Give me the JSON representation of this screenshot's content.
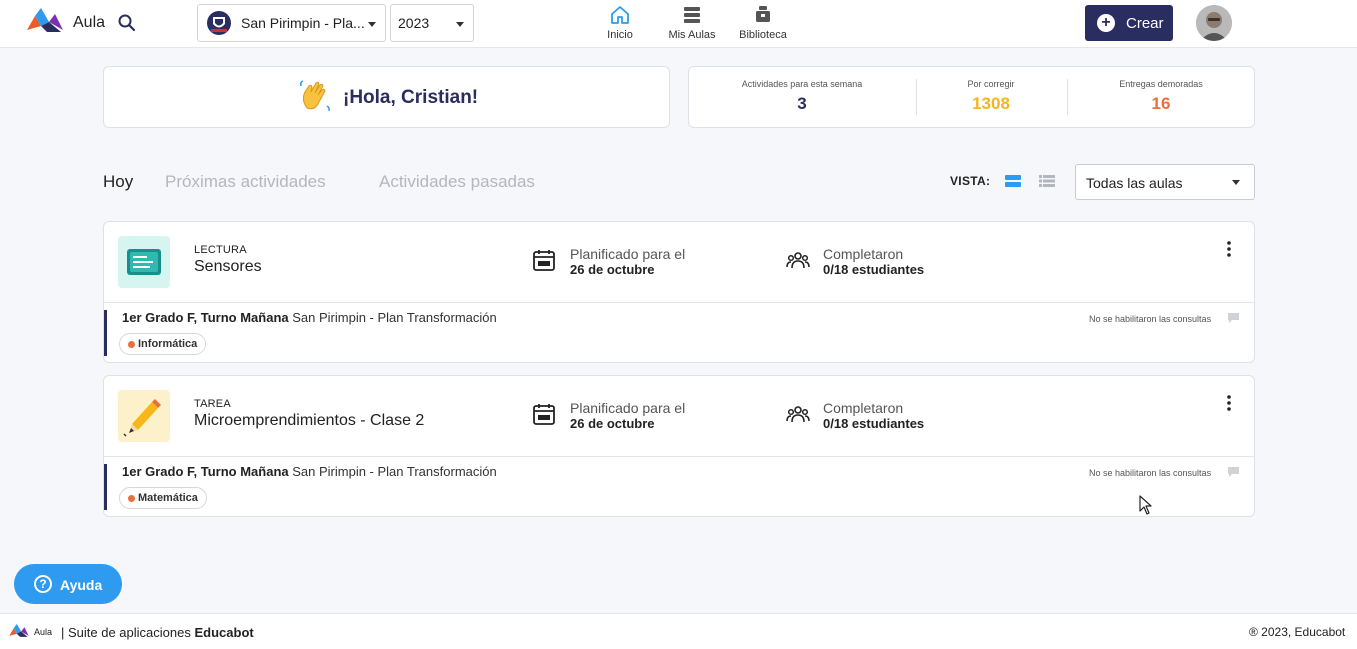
{
  "header": {
    "app_name": "Aula",
    "school_select": "San Pirimpin - Pla...",
    "year_select": "2023",
    "nav": [
      {
        "label": "Inicio",
        "icon": "home-icon",
        "active": true
      },
      {
        "label": "Mis Aulas",
        "icon": "classrooms-icon",
        "active": false
      },
      {
        "label": "Biblioteca",
        "icon": "library-icon",
        "active": false
      }
    ],
    "create_label": "Crear"
  },
  "greeting": {
    "text": "¡Hola, Cristian!"
  },
  "stats": [
    {
      "label": "Actividades para esta semana",
      "value": "3",
      "color": "#2a2d5f"
    },
    {
      "label": "Por corregir",
      "value": "1308",
      "color": "#f5b41a"
    },
    {
      "label": "Entregas demoradas",
      "value": "16",
      "color": "#e8703a"
    }
  ],
  "tabs": [
    {
      "label": "Hoy",
      "active": true
    },
    {
      "label": "Próximas actividades",
      "active": false
    },
    {
      "label": "Actividades pasadas",
      "active": false
    }
  ],
  "view": {
    "label": "VISTA:",
    "filter": "Todas las aulas"
  },
  "activities": [
    {
      "type": "LECTURA",
      "title": "Sensores",
      "plan_label": "Planificado para el",
      "plan_date": "26 de octubre",
      "completed_label": "Completaron",
      "completed_value": "0/18 estudiantes",
      "class_name": "1er Grado F, Turno Mañana",
      "school": "San Pirimpin - Plan Transformación",
      "subject": "Informática",
      "consult_note": "No se habilitaron las consultas"
    },
    {
      "type": "TAREA",
      "title": "Microemprendimientos - Clase 2",
      "plan_label": "Planificado para el",
      "plan_date": "26 de octubre",
      "completed_label": "Completaron",
      "completed_value": "0/18 estudiantes",
      "class_name": "1er Grado F, Turno Mañana",
      "school": "San Pirimpin - Plan Transformación",
      "subject": "Matemática",
      "consult_note": "No se habilitaron las consultas"
    }
  ],
  "help": {
    "label": "Ayuda"
  },
  "footer": {
    "logo_text": "Aula",
    "suite_prefix": "| Suite de aplicaciones",
    "suite_brand": "Educabot",
    "copyright": "® 2023, Educabot"
  },
  "colors": {
    "brand": "#2a2d5f",
    "accent_blue": "#2e9bf0",
    "orange": "#e8703a",
    "yellow": "#f5b41a"
  }
}
